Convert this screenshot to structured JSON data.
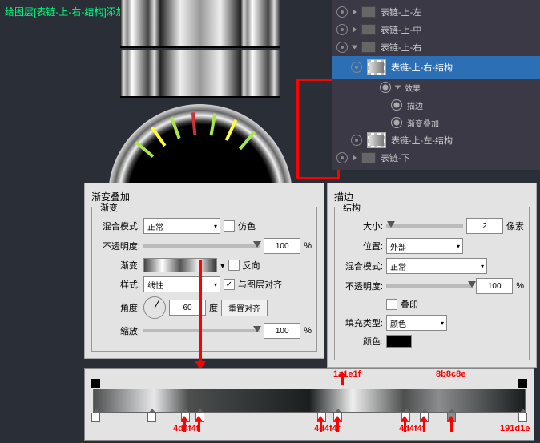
{
  "annotation": "给图层[表链-上-右-结构]添加描边、渐变叠加",
  "layers": {
    "items": [
      {
        "name": "表链-上-左"
      },
      {
        "name": "表链-上-中"
      },
      {
        "name": "表链-上-右"
      },
      {
        "name": "表链-上-右-结构"
      },
      {
        "name": "表链-上-左-结构"
      },
      {
        "name": "表链-下"
      }
    ],
    "fx_label": "效果",
    "fx_stroke": "描边",
    "fx_grad": "渐变叠加"
  },
  "gradientOverlay": {
    "title": "渐变叠加",
    "section": "渐变",
    "blend_label": "混合模式:",
    "blend_value": "正常",
    "dither": "仿色",
    "opacity_label": "不透明度:",
    "opacity_value": "100",
    "pct": "%",
    "grad_label": "渐变:",
    "reverse": "反向",
    "style_label": "样式:",
    "style_value": "线性",
    "align": "与图层对齐",
    "angle_label": "角度:",
    "angle_value": "60",
    "angle_unit": "度",
    "reset": "重置对齐",
    "scale_label": "缩放:",
    "scale_value": "100"
  },
  "stroke": {
    "title": "描边",
    "section": "结构",
    "size_label": "大小:",
    "size_value": "2",
    "size_unit": "像素",
    "pos_label": "位置:",
    "pos_value": "外部",
    "blend_label": "混合模式:",
    "blend_value": "正常",
    "opacity_label": "不透明度:",
    "opacity_value": "100",
    "pct": "%",
    "overprint": "叠印",
    "fill_label": "填充类型:",
    "fill_value": "颜色",
    "color_label": "颜色:"
  },
  "chart_data": {
    "type": "gradient",
    "angle": 60,
    "style": "线性",
    "opacity": 100,
    "scale": 100,
    "color_stops": [
      {
        "pos": 0,
        "hex": "4d4f4f"
      },
      {
        "pos": 14,
        "hex": "e8e8ea"
      },
      {
        "pos": 22,
        "hex": "4d4f4f"
      },
      {
        "pos": 50,
        "hex": "1a1e1f"
      },
      {
        "pos": 60,
        "hex": "eeeeee"
      },
      {
        "pos": 72,
        "hex": "4d4f4f"
      },
      {
        "pos": 80,
        "hex": "8b8c8e"
      },
      {
        "pos": 100,
        "hex": "191d1e"
      }
    ],
    "opacity_stops": [
      {
        "pos": 0,
        "opacity": 100
      },
      {
        "pos": 100,
        "opacity": 100
      }
    ],
    "labeled_stops": {
      "4d4f4f": [
        22,
        27,
        72
      ],
      "1a1e1f": [
        50
      ],
      "8b8c8e": [
        80
      ],
      "191d1e": [
        100
      ]
    }
  },
  "stop_labels": {
    "a": "4d4f4f",
    "b": "4d4f4f",
    "c": "1a1e1f",
    "d": "4d4f4f",
    "e": "8b8c8e",
    "f": "191d1e"
  }
}
